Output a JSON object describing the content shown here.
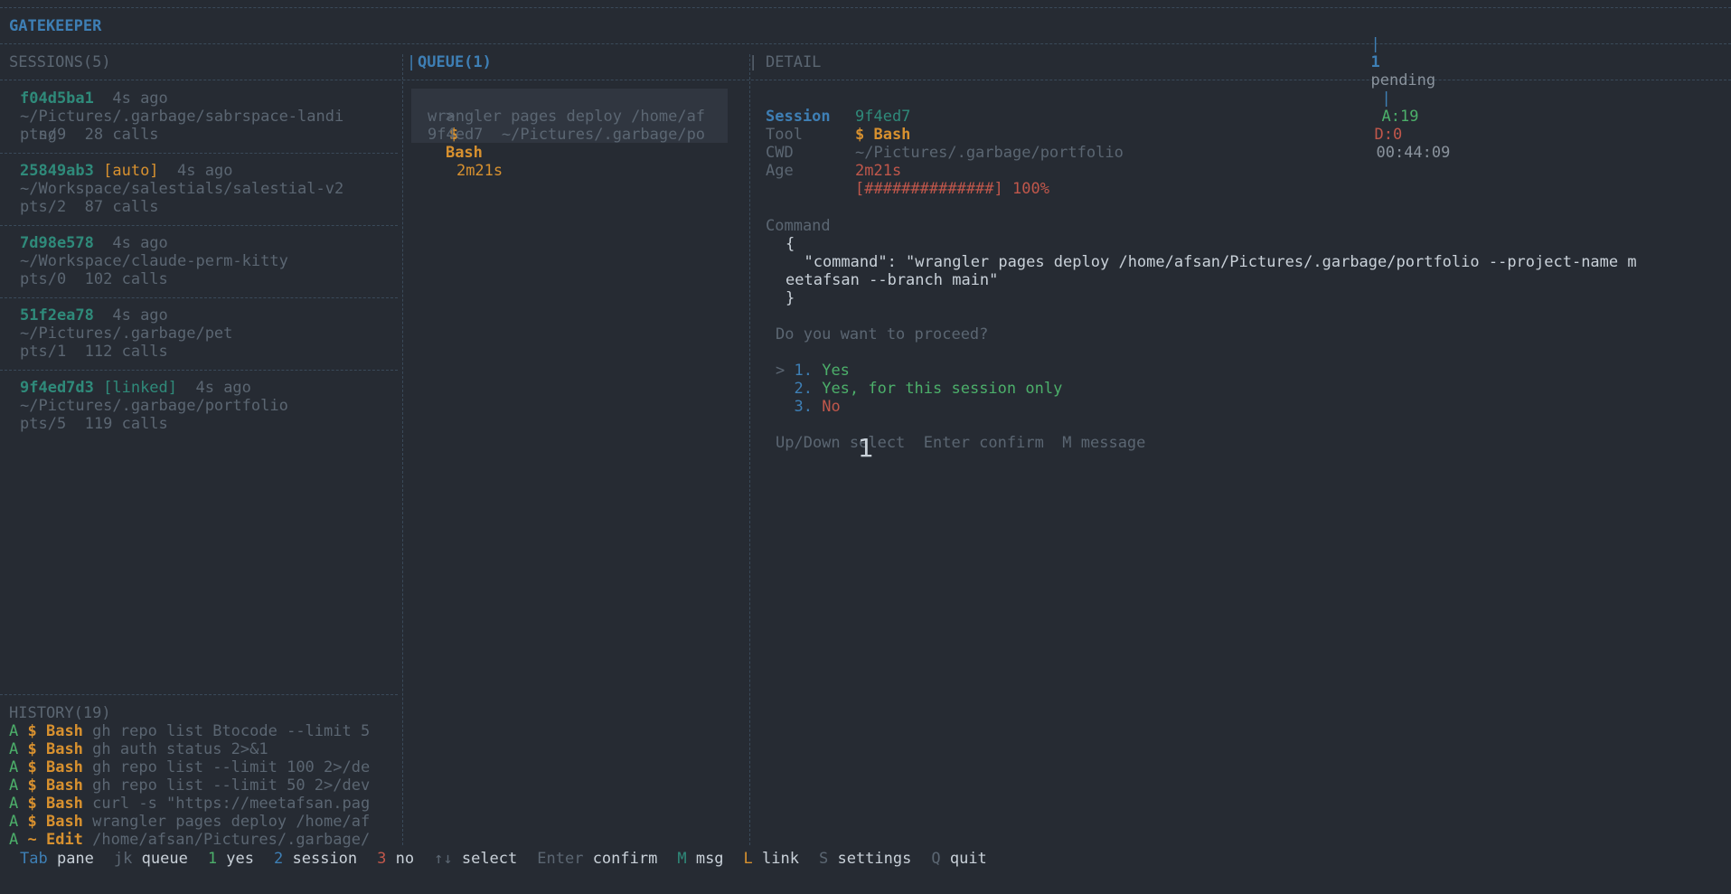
{
  "header": {
    "title": "GATEKEEPER",
    "pipe1": "|",
    "pending_count": "1",
    "pending_label": "pending",
    "pipe2": "|",
    "approved": "A:19",
    "denied": "D:0",
    "clock": "00:44:09"
  },
  "sessions": {
    "title": "SESSIONS(5)",
    "items": [
      {
        "id": "f04d5ba1",
        "tag": "",
        "age": "4s ago",
        "path1": "~/Pictures/.garbage/sabrspace-landi",
        "path2": "  ng",
        "tty": "pts/9",
        "calls": "28 calls"
      },
      {
        "id": "25849ab3",
        "tag": "[auto]",
        "age": "4s ago",
        "path1": "~/Workspace/salestials/salestial-v2",
        "path2": "",
        "tty": "pts/2",
        "calls": "87 calls"
      },
      {
        "id": "7d98e578",
        "tag": "",
        "age": "4s ago",
        "path1": "~/Workspace/claude-perm-kitty",
        "path2": "",
        "tty": "pts/0",
        "calls": "102 calls"
      },
      {
        "id": "51f2ea78",
        "tag": "",
        "age": "4s ago",
        "path1": "~/Pictures/.garbage/pet",
        "path2": "",
        "tty": "pts/1",
        "calls": "112 calls"
      },
      {
        "id": "9f4ed7d3",
        "tag": "[linked]",
        "age": "4s ago",
        "path1": "~/Pictures/.garbage/portfolio",
        "path2": "",
        "tty": "pts/5",
        "calls": "119 calls"
      }
    ]
  },
  "history": {
    "title": "HISTORY(19)",
    "items": [
      {
        "flag": "A",
        "sym": "$",
        "tool": "Bash",
        "cmd": "gh repo list Btocode --limit 5"
      },
      {
        "flag": "A",
        "sym": "$",
        "tool": "Bash",
        "cmd": "gh auth status 2>&1"
      },
      {
        "flag": "A",
        "sym": "$",
        "tool": "Bash",
        "cmd": "gh repo list --limit 100 2>/de"
      },
      {
        "flag": "A",
        "sym": "$",
        "tool": "Bash",
        "cmd": "gh repo list --limit 50 2>/dev"
      },
      {
        "flag": "A",
        "sym": "$",
        "tool": "Bash",
        "cmd": "curl -s \"https://meetafsan.pag"
      },
      {
        "flag": "A",
        "sym": "$",
        "tool": "Bash",
        "cmd": "wrangler pages deploy /home/af"
      },
      {
        "flag": "A",
        "sym": "~",
        "tool": "Edit",
        "cmd": "/home/afsan/Pictures/.garbage/"
      }
    ]
  },
  "queue": {
    "title": "QUEUE(1)",
    "item": {
      "caret": ">",
      "sym": "$",
      "tool": "Bash",
      "age": "2m21s",
      "cmd": "wrangler pages deploy /home/af",
      "meta": "9f4ed7  ~/Pictures/.garbage/po"
    }
  },
  "detail": {
    "title": "DETAIL",
    "session_label": "Session",
    "session_value": "9f4ed7",
    "tool_label": "Tool",
    "tool_value": "$ Bash",
    "cwd_label": "CWD",
    "cwd_value": "~/Pictures/.garbage/portfolio",
    "age_label": "Age",
    "age_value": "2m21s",
    "progress": "[##############] 100%",
    "progress_fraction": 1.0,
    "command_label": "Command",
    "json_open": "{",
    "json_line1": "  \"command\": \"wrangler pages deploy /home/afsan/Pictures/.garbage/portfolio --project-name m",
    "json_line2": "eetafsan --branch main\"",
    "json_close": "}",
    "prompt": "Do you want to proceed?",
    "options": [
      {
        "caret": ">",
        "num": "1.",
        "label": "Yes"
      },
      {
        "caret": " ",
        "num": "2.",
        "label": "Yes, for this session only"
      },
      {
        "caret": " ",
        "num": "3.",
        "label": "No"
      }
    ],
    "hints": "Up/Down select  Enter confirm  M message",
    "overlay_badge": "1"
  },
  "footer": [
    {
      "key": "Tab",
      "label": "pane"
    },
    {
      "key": "jk",
      "label": "queue"
    },
    {
      "key": "1",
      "label": "yes"
    },
    {
      "key": "2",
      "label": "session"
    },
    {
      "key": "3",
      "label": "no"
    },
    {
      "key": "↑↓",
      "label": "select"
    },
    {
      "key": "Enter",
      "label": "confirm"
    },
    {
      "key": "M",
      "label": "msg"
    },
    {
      "key": "L",
      "label": "link"
    },
    {
      "key": "S",
      "label": "settings"
    },
    {
      "key": "Q",
      "label": "quit"
    }
  ]
}
